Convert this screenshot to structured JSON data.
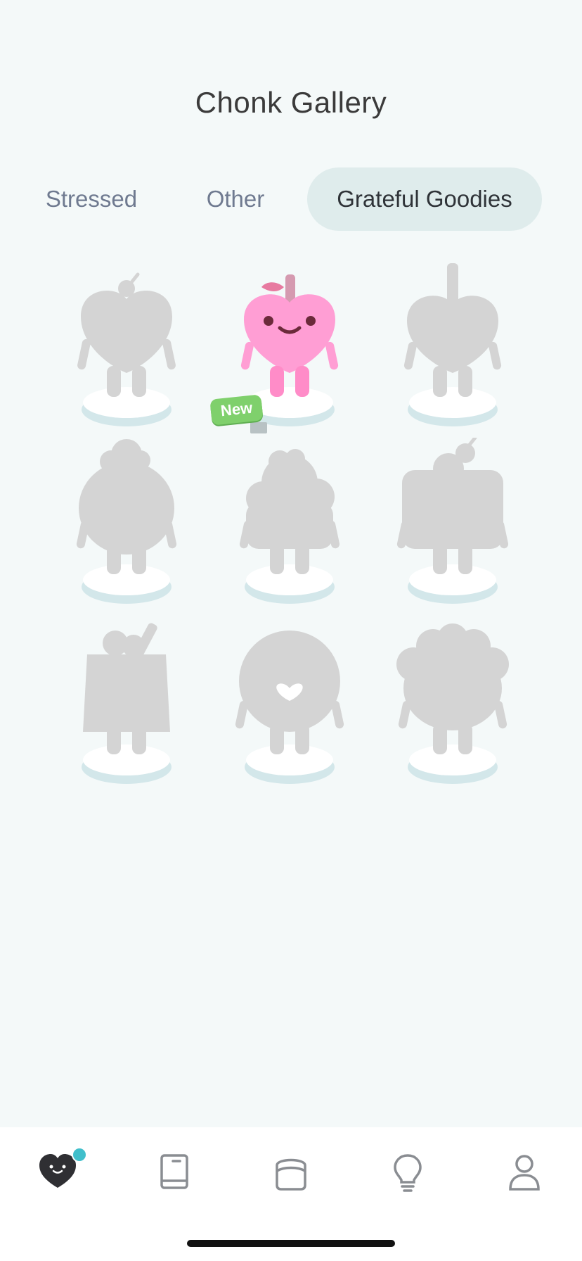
{
  "header": {
    "title": "Chonk Gallery"
  },
  "tabs": [
    {
      "label": "Stressed",
      "active": false
    },
    {
      "label": "Other",
      "active": false
    },
    {
      "label": "Grateful Goodies",
      "active": true
    }
  ],
  "gallery": {
    "items": [
      {
        "id": "silhouette-apple-leaf",
        "unlocked": false
      },
      {
        "id": "pink-heart-apple",
        "unlocked": true,
        "badge": "New"
      },
      {
        "id": "silhouette-heart-stick",
        "unlocked": false
      },
      {
        "id": "silhouette-round-bun",
        "unlocked": false
      },
      {
        "id": "silhouette-cupcake",
        "unlocked": false
      },
      {
        "id": "silhouette-cake-cherry",
        "unlocked": false
      },
      {
        "id": "silhouette-drink-cup",
        "unlocked": false
      },
      {
        "id": "silhouette-donut",
        "unlocked": false
      },
      {
        "id": "silhouette-cauliflower",
        "unlocked": false
      }
    ]
  },
  "nav": {
    "items": [
      {
        "name": "home-heart-icon",
        "active": true,
        "notification": true
      },
      {
        "name": "journal-book-icon",
        "active": false
      },
      {
        "name": "chonk-room-icon",
        "active": false
      },
      {
        "name": "ideas-lightbulb-icon",
        "active": false
      },
      {
        "name": "profile-person-icon",
        "active": false
      }
    ]
  },
  "colors": {
    "background": "#f4f9f9",
    "active_tab_bg": "#dfecec",
    "silhouette": "#d4d4d4",
    "badge_green": "#7fd06c",
    "notification_dot": "#41bfcb"
  }
}
